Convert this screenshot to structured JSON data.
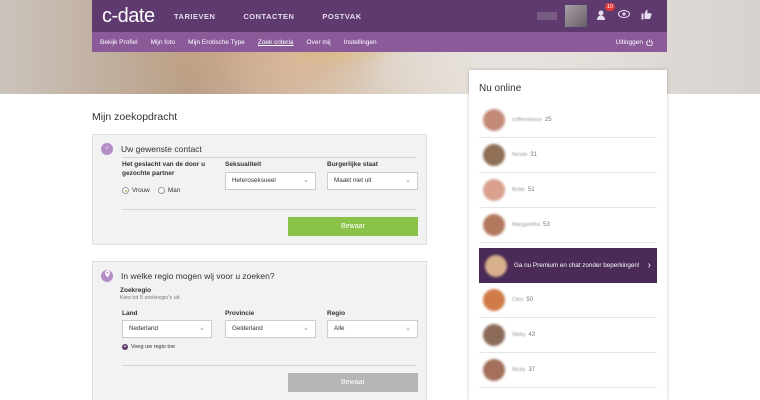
{
  "header": {
    "logo": "c-date",
    "nav": [
      "TARIEVEN",
      "CONTACTEN",
      "POSTVAK"
    ],
    "notification_count": "10",
    "submenu": [
      "Bekijk Profiel",
      "Mijn foto",
      "Mijn Erotische Type",
      "Zoek criteria",
      "Over mij",
      "Instellingen"
    ],
    "active_submenu": "Zoek criteria",
    "logout": "Uitloggen"
  },
  "main": {
    "page_title": "Mijn zoekopdracht",
    "contact_card": {
      "title": "Uw gewenste contact",
      "gender_label": "Het geslacht van de door u gezochte partner",
      "gender_options": [
        "Vrouw",
        "Man"
      ],
      "gender_selected": "Vrouw",
      "sexuality_label": "Seksualiteit",
      "sexuality_value": "Heteroseksueel",
      "status_label": "Burgerlijke staat",
      "status_value": "Maakt niet uit",
      "save": "Bewaar"
    },
    "region_card": {
      "title": "In welke regio mogen wij voor u zoeken?",
      "subtitle": "Zoekregio",
      "hint": "Kies tot 5 zoekregio's uit.",
      "country_label": "Land",
      "country_value": "Nederland",
      "province_label": "Provincie",
      "province_value": "Gelderland",
      "region_label": "Regio",
      "region_value": "Alle",
      "add_region": "Voeg uw regio toe",
      "save": "Bewaar"
    }
  },
  "online": {
    "title": "Nu online",
    "users": [
      {
        "name": "coffeedance",
        "age": "25",
        "color": "#c48a78"
      },
      {
        "name": "Nicole",
        "age": "31",
        "color": "#8f6f55"
      },
      {
        "name": "Bebe",
        "age": "51",
        "color": "#d9a08e"
      },
      {
        "name": "Margaretha",
        "age": "53",
        "color": "#b3795f"
      }
    ],
    "promo": "Ga nu Premium en chat zonder beperkingen!",
    "users2": [
      {
        "name": "Cleo",
        "age": "50",
        "color": "#d07a48"
      },
      {
        "name": "Nikky",
        "age": "43",
        "color": "#8b6a58"
      },
      {
        "name": "Nicky",
        "age": "37",
        "color": "#a46f5b"
      }
    ]
  }
}
